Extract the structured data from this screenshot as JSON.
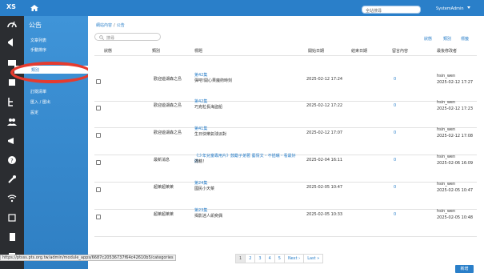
{
  "topbar": {
    "logo": "XS",
    "search_placeholder": "全站搜尋",
    "user": "SystemAdmin"
  },
  "left_panel": {
    "title": "公告",
    "items": [
      {
        "label": "文章列表",
        "active": false
      },
      {
        "label": "手動排序",
        "active": false
      },
      {
        "label": "類別",
        "active": true
      },
      {
        "label": "訂閱清單",
        "active": false
      },
      {
        "label": "匯入 / 匯出",
        "active": false
      },
      {
        "label": "設定",
        "active": false
      }
    ]
  },
  "breadcrumb": [
    "網站內容",
    "公告"
  ],
  "search": {
    "placeholder": "搜尋"
  },
  "top_links": [
    "狀態",
    "類別",
    "標籤"
  ],
  "table": {
    "headers": [
      "狀態",
      "類別",
      "標題",
      "開始日期",
      "結束日期",
      "留言內容",
      "最後修改者"
    ],
    "rows": [
      {
        "category": "歡迎遊湖森之島",
        "title_top": "第42集",
        "title_main": "彈吧!開心果魔術時刻",
        "start": "2025-02-12 17:24",
        "count": "0",
        "modifier": "hsin_wen",
        "modified": "2025-02-12 17:27"
      },
      {
        "category": "歡迎遊湖森之島",
        "title_top": "第42集",
        "title_main": "巧克粒長海盜船",
        "start": "2025-02-12 17:22",
        "count": "0",
        "modifier": "hsin_wen",
        "modified": "2025-02-12 17:23"
      },
      {
        "category": "歡迎遊湖森之島",
        "title_top": "第41集",
        "title_main": "生日快樂氣球派對",
        "start": "2025-02-12 17:07",
        "count": "0",
        "modifier": "hsin_wen",
        "modified": "2025-02-12 17:08"
      },
      {
        "category": "最新消息",
        "title_top": "《少年兒童專用片》鼓勵子弟著 藝情文・不插嘴・看最好的",
        "title_main": "滿藉！",
        "start": "2025-02-04 16:11",
        "count": "0",
        "modifier": "hsin_wen",
        "modified": "2025-02-06 16:09"
      },
      {
        "category": "超萊超萊萊",
        "title_top": "第24集",
        "title_main": "國民小天菜",
        "start": "2025-02-05 10:47",
        "count": "0",
        "modifier": "hsin_wen",
        "modified": "2025-02-05 10:47"
      },
      {
        "category": "超萊超萊萊",
        "title_top": "第23集",
        "title_main": "揭影迷人凱奕偶",
        "start": "2025-02-05 10:33",
        "count": "0",
        "modifier": "hsin_wen",
        "modified": "2025-02-05 10:48"
      }
    ]
  },
  "pager": [
    "1",
    "2",
    "3",
    "4",
    "5",
    "Next ›",
    "Last »"
  ],
  "add_button": "新增",
  "status_url": "https://ptsss.pts.org.tw/admin/module_apps/6687c20536737f64c42610b5/categories",
  "colors": {
    "brand": "#2a7fc9",
    "highlight": "#e53b2f"
  }
}
